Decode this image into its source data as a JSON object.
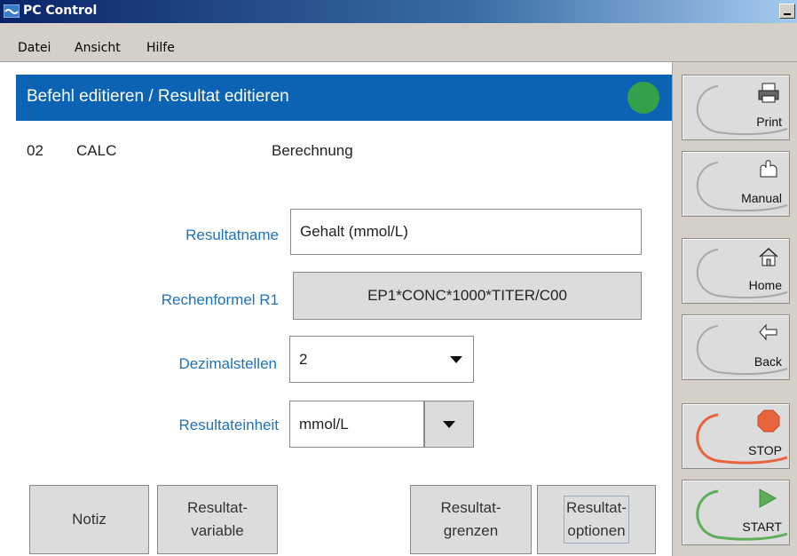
{
  "window": {
    "title": "PC Control"
  },
  "menu": [
    "Datei",
    "Ansicht",
    "Hilfe"
  ],
  "header": {
    "title": "Befehl editieren / Resultat editieren",
    "status_color": "#35a04a"
  },
  "command": {
    "number": "02",
    "name": "CALC",
    "description": "Berechnung"
  },
  "form": {
    "resultname_label": "Resultatname",
    "resultname_value": "Gehalt (mmol/L)",
    "formula_label": "Rechenformel R1",
    "formula_value": "EP1*CONC*1000*TITER/C00",
    "decimals_label": "Dezimalstellen",
    "decimals_value": "2",
    "unit_label": "Resultateinheit",
    "unit_value": "mmol/L"
  },
  "buttons": {
    "notiz": "Notiz",
    "variable_1": "Resultat-",
    "variable_2": "variable",
    "grenzen_1": "Resultat-",
    "grenzen_2": "grenzen",
    "optionen_1": "Resultat-",
    "optionen_2": "optionen"
  },
  "side": {
    "print": "Print",
    "manual": "Manual",
    "home": "Home",
    "back": "Back",
    "stop": "STOP",
    "start": "START"
  },
  "colors": {
    "accent": "#0d63b3",
    "label": "#1d72b8",
    "stop": "#e8643c",
    "start": "#5fae5a"
  }
}
